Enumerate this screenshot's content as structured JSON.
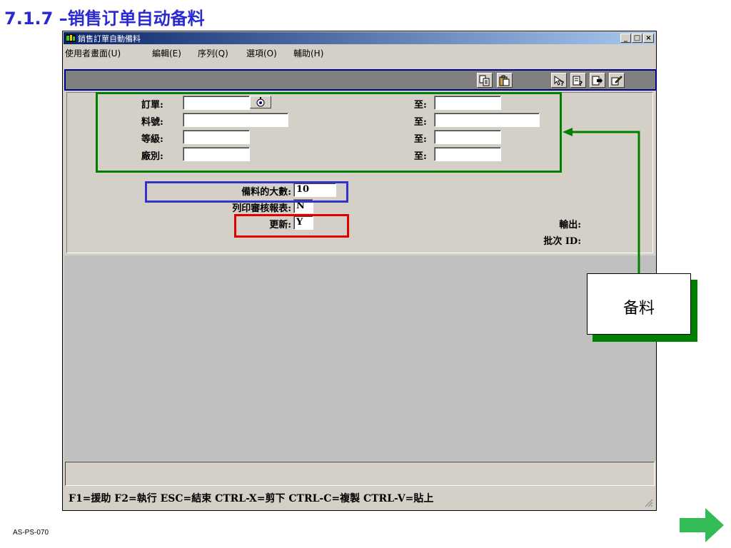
{
  "slide": {
    "title": "7.1.7 –销售订单自动备料",
    "footer_code": "AS-PS-070"
  },
  "window": {
    "title": "銷售訂單自動備料",
    "min_label": "_",
    "max_label": "□",
    "close_label": "×"
  },
  "menu": [
    {
      "label": "使用者畫面(U)"
    },
    {
      "label": "編輯(E)"
    },
    {
      "label": "序列(Q)"
    },
    {
      "label": "選項(O)"
    },
    {
      "label": "輔助(H)"
    }
  ],
  "toolbar": {
    "icons": [
      "copy-icon",
      "paste-icon",
      "context-help-icon",
      "field-help-icon",
      "exit-icon",
      "process-icon"
    ]
  },
  "form": {
    "order_label": "訂單:",
    "item_label": "料號:",
    "grade_label": "等級:",
    "plant_label": "廠別:",
    "to_label": "至:",
    "order_from": "",
    "order_to": "",
    "item_from": "",
    "item_to": "",
    "grade_from": "",
    "grade_to": "",
    "plant_from": "",
    "plant_to": "",
    "max_alloc_label": "備料的大數:",
    "max_alloc_value": "10",
    "print_audit_label": "列印審核報表:",
    "print_audit_value": "N",
    "update_label": "更新:",
    "update_value": "Y",
    "output_label": "輸出:",
    "batch_id_label": "批次 ID:"
  },
  "statusbar": {
    "text": "F1=援助 F2=執行 ESC=結束 CTRL-X=剪下 CTRL-C=複製 CTRL-V=貼上"
  },
  "callout": {
    "text": "备料"
  },
  "colors": {
    "green": "#008000",
    "blue": "#3333cc",
    "red": "#e00000",
    "title_blue": "#2a2ad0"
  }
}
